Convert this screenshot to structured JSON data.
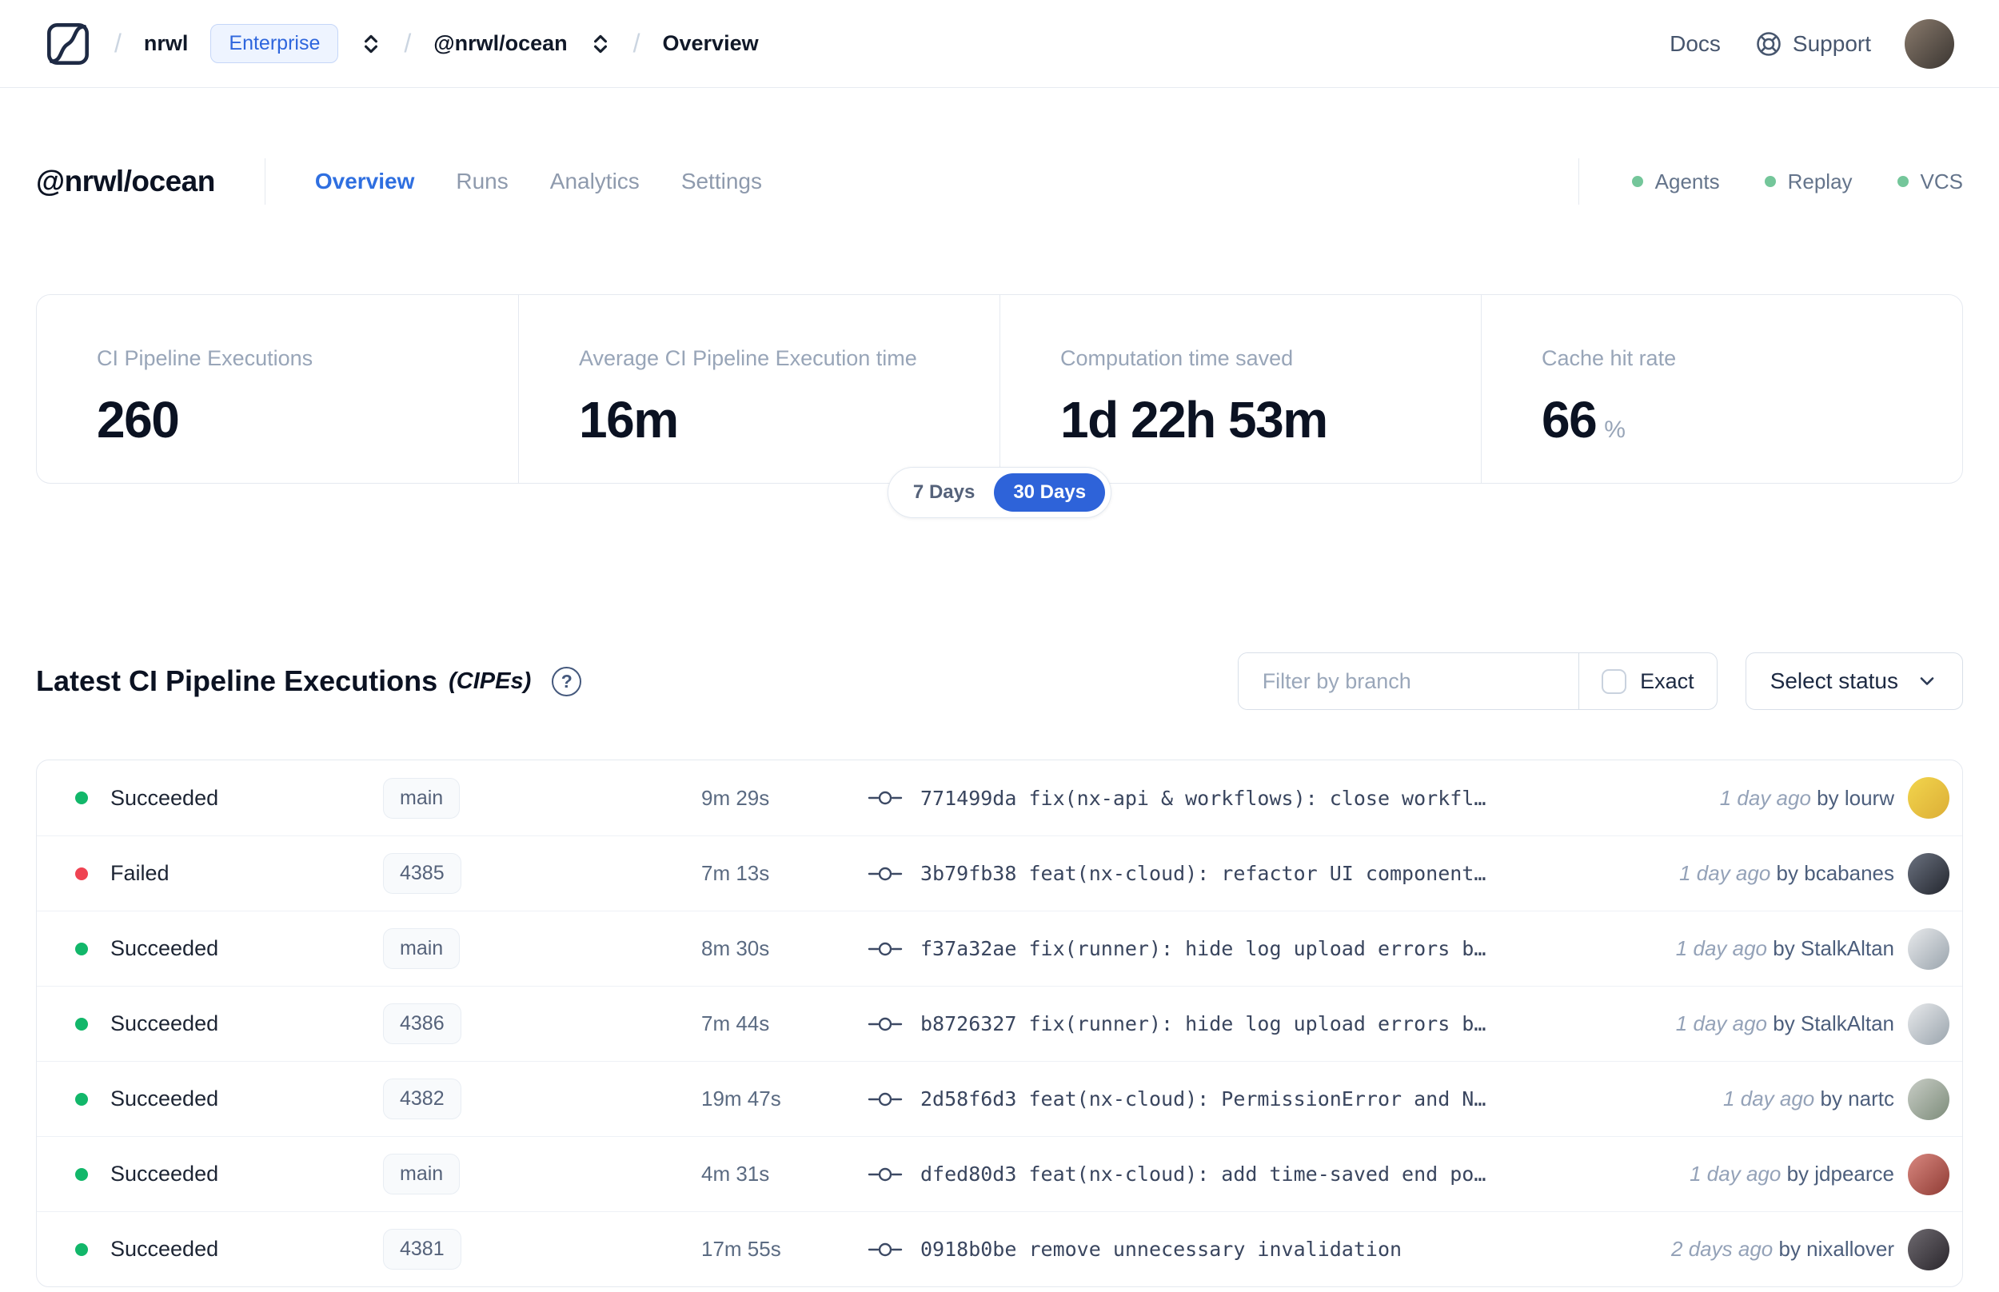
{
  "colors": {
    "accent": "#2e66dd",
    "badge_bg": "#eef4ff",
    "badge_border": "#c5d6f8",
    "status_green": "#12b76a",
    "status_red": "#ef4352",
    "feature_green": "#74c69a"
  },
  "nav": {
    "logo_icon": "nx-cloud-logo",
    "breadcrumb": {
      "org": "nrwl",
      "org_badge": "Enterprise",
      "workspace": "@nrwl/ocean",
      "page": "Overview"
    },
    "docs_label": "Docs",
    "support_label": "Support",
    "support_icon": "lifebuoy-icon",
    "user_avatar_colors": [
      "#8a7b6d",
      "#3a3531"
    ]
  },
  "header": {
    "title": "@nrwl/ocean",
    "tabs": [
      {
        "label": "Overview",
        "active": true
      },
      {
        "label": "Runs",
        "active": false
      },
      {
        "label": "Analytics",
        "active": false
      },
      {
        "label": "Settings",
        "active": false
      }
    ],
    "features": [
      {
        "label": "Agents"
      },
      {
        "label": "Replay"
      },
      {
        "label": "VCS"
      }
    ]
  },
  "stats": {
    "cards": [
      {
        "label": "CI Pipeline Executions",
        "value": "260"
      },
      {
        "label": "Average CI Pipeline Execution time",
        "value": "16m"
      },
      {
        "label": "Computation time saved",
        "value": "1d 22h 53m"
      },
      {
        "label": "Cache hit rate",
        "value": "66",
        "suffix": "%"
      }
    ],
    "range": {
      "options": [
        {
          "label": "7 Days",
          "active": false
        },
        {
          "label": "30 Days",
          "active": true
        }
      ]
    }
  },
  "cipe": {
    "title": "Latest CI Pipeline Executions",
    "subtitle": "(CIPEs)",
    "help_icon": "question-circle-icon",
    "filter_placeholder": "Filter by branch",
    "exact_label": "Exact",
    "select_status_label": "Select status",
    "rows": [
      {
        "status": "Succeeded",
        "status_color": "#12b76a",
        "branch": "main",
        "duration": "9m 29s",
        "commit": "771499da fix(nx-api & workflows): close workfl…",
        "time": "1 day ago",
        "author": "by lourw",
        "avatar_colors": [
          "#f2d54d",
          "#dcae36"
        ]
      },
      {
        "status": "Failed",
        "status_color": "#ef4352",
        "branch": "4385",
        "duration": "7m 13s",
        "commit": "3b79fb38 feat(nx-cloud): refactor UI component…",
        "time": "1 day ago",
        "author": "by bcabanes",
        "avatar_colors": [
          "#6b7280",
          "#23262e"
        ]
      },
      {
        "status": "Succeeded",
        "status_color": "#12b76a",
        "branch": "main",
        "duration": "8m 30s",
        "commit": "f37a32ae fix(runner): hide log upload errors b…",
        "time": "1 day ago",
        "author": "by StalkAltan",
        "avatar_colors": [
          "#e8eaec",
          "#9aa4ad"
        ]
      },
      {
        "status": "Succeeded",
        "status_color": "#12b76a",
        "branch": "4386",
        "duration": "7m 44s",
        "commit": "b8726327 fix(runner): hide log upload errors b…",
        "time": "1 day ago",
        "author": "by StalkAltan",
        "avatar_colors": [
          "#e8eaec",
          "#9aa4ad"
        ]
      },
      {
        "status": "Succeeded",
        "status_color": "#12b76a",
        "branch": "4382",
        "duration": "19m 47s",
        "commit": "2d58f6d3 feat(nx-cloud): PermissionError and N…",
        "time": "1 day ago",
        "author": "by nartc",
        "avatar_colors": [
          "#c8cdc6",
          "#7d8c7a"
        ]
      },
      {
        "status": "Succeeded",
        "status_color": "#12b76a",
        "branch": "main",
        "duration": "4m 31s",
        "commit": "dfed80d3 feat(nx-cloud): add time-saved end po…",
        "time": "1 day ago",
        "author": "by jdpearce",
        "avatar_colors": [
          "#d98880",
          "#8f3b34"
        ]
      },
      {
        "status": "Succeeded",
        "status_color": "#12b76a",
        "branch": "4381",
        "duration": "17m 55s",
        "commit": "0918b0be remove unnecessary invalidation",
        "time": "2 days ago",
        "author": "by nixallover",
        "avatar_colors": [
          "#6e6a70",
          "#2a262c"
        ]
      }
    ]
  }
}
